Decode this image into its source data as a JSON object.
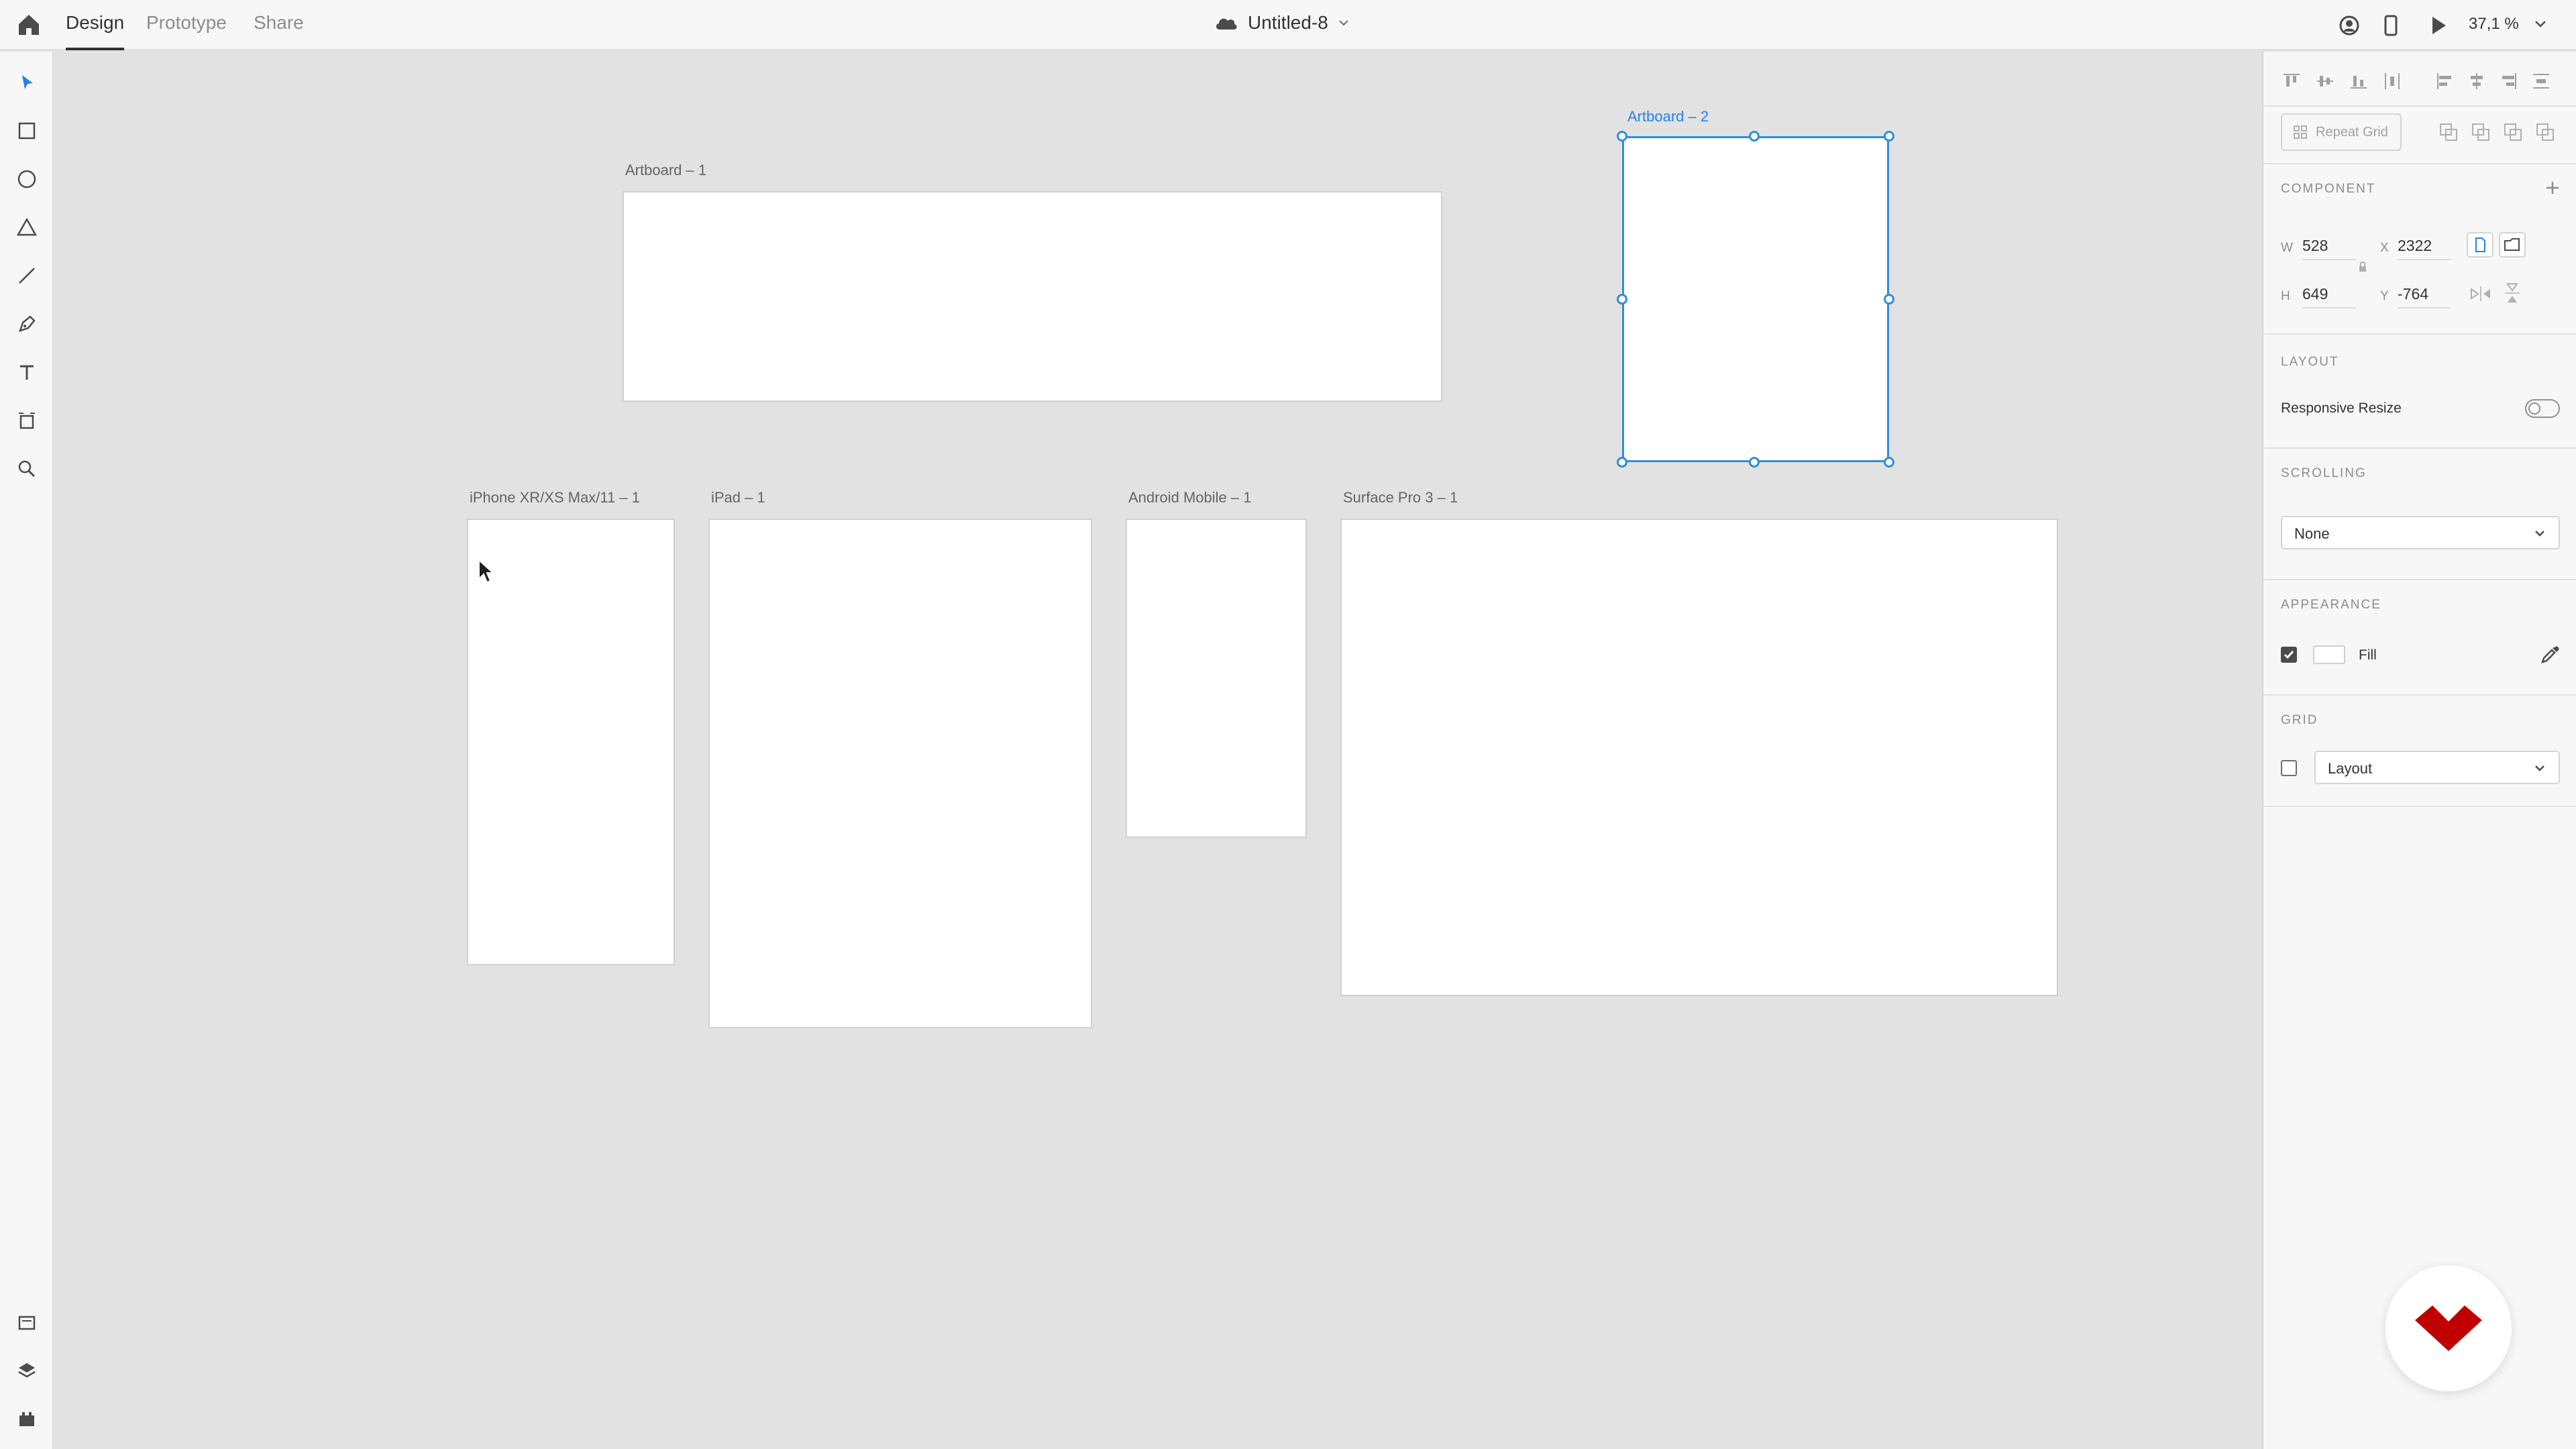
{
  "topbar": {
    "tabs": [
      {
        "label": "Design",
        "active": true
      },
      {
        "label": "Prototype",
        "active": false
      },
      {
        "label": "Share",
        "active": false
      }
    ],
    "document_title": "Untitled-8",
    "zoom": "37,1 %"
  },
  "toolbar": {
    "tools": [
      "select-tool",
      "rectangle-tool",
      "ellipse-tool",
      "polygon-tool",
      "line-tool",
      "pen-tool",
      "text-tool",
      "artboard-tool",
      "zoom-tool"
    ],
    "bottom": [
      "assets-panel",
      "layers-panel",
      "plugins-panel"
    ]
  },
  "canvas": {
    "artboards": [
      {
        "label": "Artboard – 1",
        "selected": false
      },
      {
        "label": "Artboard – 2",
        "selected": true
      },
      {
        "label": "iPhone XR/XS Max/11 – 1",
        "selected": false
      },
      {
        "label": "iPad – 1",
        "selected": false
      },
      {
        "label": "Android Mobile – 1",
        "selected": false
      },
      {
        "label": "Surface Pro 3 – 1",
        "selected": false
      }
    ]
  },
  "panel": {
    "repeat_grid_label": "Repeat Grid",
    "component": {
      "title": "COMPONENT"
    },
    "transform": {
      "w_label": "W",
      "w_value": "528",
      "x_label": "X",
      "x_value": "2322",
      "h_label": "H",
      "h_value": "649",
      "y_label": "Y",
      "y_value": "-764"
    },
    "layout": {
      "title": "LAYOUT",
      "responsive_resize_label": "Responsive Resize",
      "responsive_resize_on": false
    },
    "scrolling": {
      "title": "SCROLLING",
      "value": "None"
    },
    "appearance": {
      "title": "APPEARANCE",
      "fill_label": "Fill",
      "fill_checked": true,
      "fill_color": "#ffffff"
    },
    "grid": {
      "title": "GRID",
      "value": "Layout",
      "checked": false
    }
  },
  "colors": {
    "selection": "#2f8fd8",
    "logo": "#c00000"
  }
}
